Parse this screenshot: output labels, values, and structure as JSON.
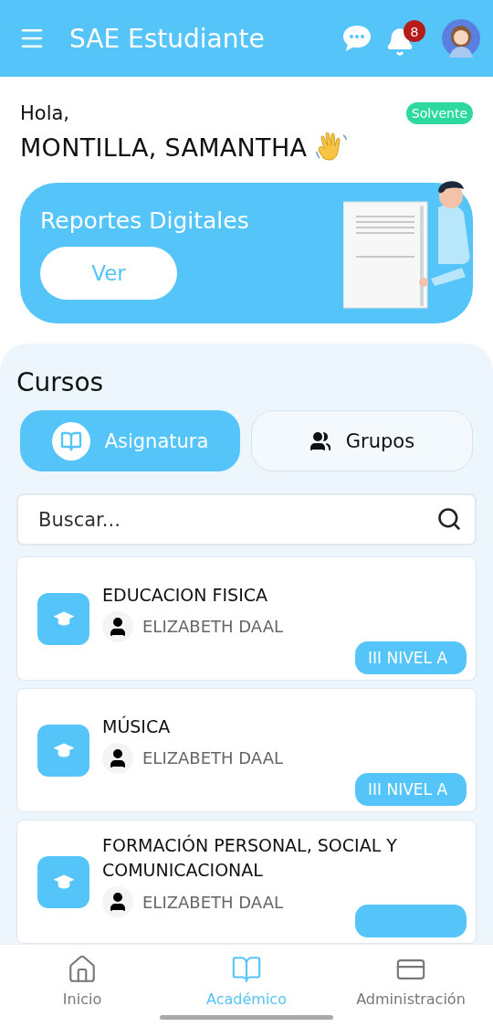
{
  "header": {
    "title": "SAE Estudiante",
    "notifications": "8"
  },
  "greeting": {
    "salutation": "Hola,",
    "name": "MONTILLA, SAMANTHA",
    "status": "Solvente"
  },
  "banner": {
    "title": "Reportes Digitales",
    "button": "Ver"
  },
  "courses": {
    "title": "Cursos",
    "tabs": [
      {
        "label": "Asignatura",
        "selected": true,
        "kind": "book"
      },
      {
        "label": "Grupos",
        "selected": false,
        "kind": "group"
      }
    ],
    "search": {
      "placeholder": "Buscar..."
    },
    "items": [
      {
        "name": "EDUCACION FISICA",
        "teacher": "ELIZABETH DAAL",
        "level": "III NIVEL A"
      },
      {
        "name": "MÚSICA",
        "teacher": "ELIZABETH DAAL",
        "level": "III NIVEL A"
      },
      {
        "name": "FORMACIÓN PERSONAL, SOCIAL Y COMUNICACIONAL",
        "teacher": "ELIZABETH DAAL"
      }
    ]
  },
  "nav": [
    {
      "label": "Inicio",
      "selected": false,
      "kind": "home"
    },
    {
      "label": "Académico",
      "selected": true,
      "kind": "book"
    },
    {
      "label": "Administración",
      "selected": false,
      "kind": "card"
    }
  ]
}
